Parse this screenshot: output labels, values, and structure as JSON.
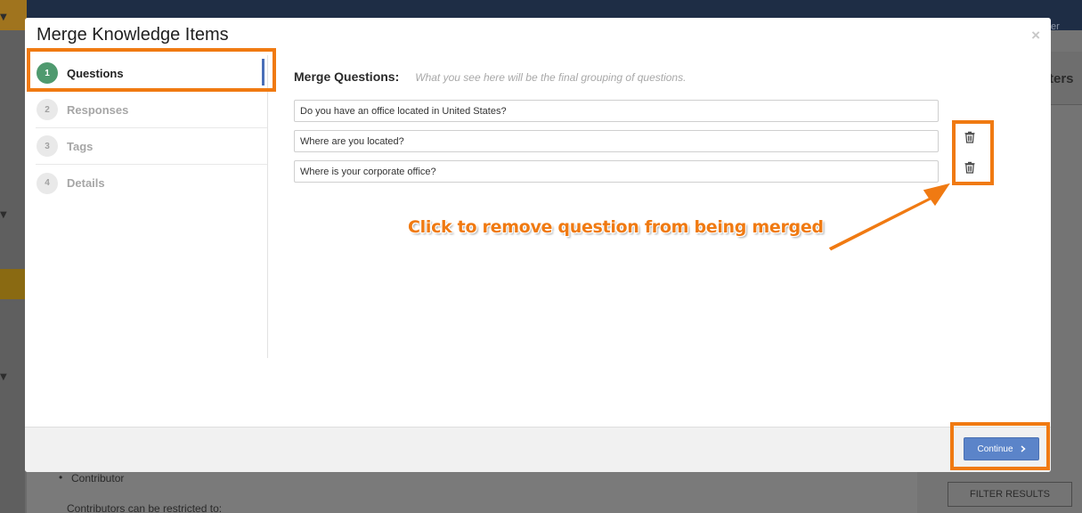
{
  "modal": {
    "title": "Merge Knowledge Items",
    "close_label": "×"
  },
  "steps": [
    {
      "number": "1",
      "label": "Questions",
      "active": true
    },
    {
      "number": "2",
      "label": "Responses",
      "active": false
    },
    {
      "number": "3",
      "label": "Tags",
      "active": false
    },
    {
      "number": "4",
      "label": "Details",
      "active": false
    }
  ],
  "merge": {
    "label": "Merge Questions:",
    "hint": "What you see here will be the final grouping of questions.",
    "questions": [
      "Do you have an office located in United States?",
      "Where are you located?",
      "Where is your corporate office?"
    ]
  },
  "annotation": {
    "text": "Click to remove question from being merged",
    "color": "#f07a12"
  },
  "footer": {
    "continue_label": "Continue"
  },
  "background": {
    "right_panel_label": "ters",
    "bullet_item": "Contributor",
    "text_line": "Contributors can be restricted to:",
    "filter_button": "FILTER RESULTS",
    "topbar_hint": "er"
  },
  "icons": {
    "close": "close-icon",
    "trash": "trash-icon",
    "chevron": "chevron-right-icon"
  }
}
